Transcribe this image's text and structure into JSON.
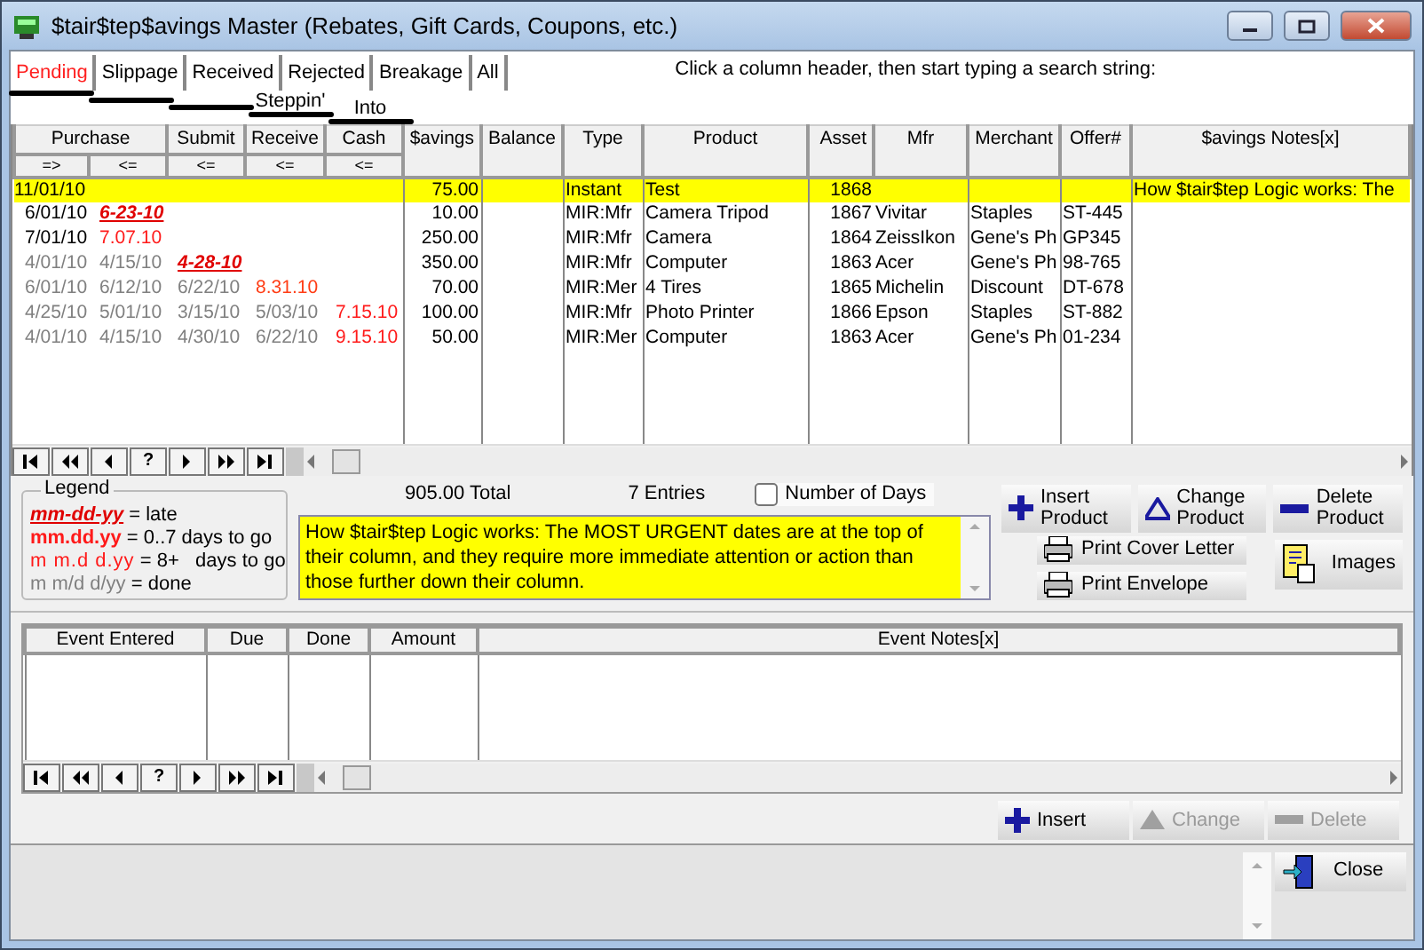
{
  "window": {
    "title": "$tair$tep$avings Master (Rebates, Gift Cards, Coupons, etc.)"
  },
  "tabs": [
    {
      "label": "Pending",
      "selected": true
    },
    {
      "label": "Slippage",
      "selected": false
    },
    {
      "label": "Received",
      "selected": false
    },
    {
      "label": "Rejected",
      "selected": false
    },
    {
      "label": "Breakage",
      "selected": false
    },
    {
      "label": "All",
      "selected": false
    }
  ],
  "stair_labels": [
    "Steppin'",
    "Into"
  ],
  "hint": "Click a column header, then start typing a search string:",
  "table": {
    "columns": [
      {
        "label": "Purchase",
        "sort": [
          "=>",
          "<="
        ]
      },
      {
        "label": "Submit",
        "sort": [
          "<="
        ]
      },
      {
        "label": "Receive",
        "sort": [
          "<="
        ]
      },
      {
        "label": "Cash",
        "sort": [
          "<="
        ]
      },
      {
        "label": "$avings",
        "numeric": true
      },
      {
        "label": "Balance"
      },
      {
        "label": "Type"
      },
      {
        "label": "Product"
      },
      {
        "label": "Asset",
        "numeric": true
      },
      {
        "label": "Mfr"
      },
      {
        "label": "Merchant"
      },
      {
        "label": "Offer#"
      },
      {
        "label": "$avings Notes[x]"
      }
    ],
    "rows": [
      {
        "selected": true,
        "dates": [
          {
            "text": "11/01/10",
            "kind": "open"
          }
        ],
        "savings": "75.00",
        "type": "Instant",
        "product": "Test",
        "asset": "1868",
        "notes": "How $tair$tep Logic works: The"
      },
      {
        "selected": false,
        "dates": [
          {
            "text": "6/01/10",
            "kind": "open"
          },
          {
            "text": "6-23-10",
            "kind": "late"
          }
        ],
        "savings": "10.00",
        "type": "MIR:Mfr",
        "product": "Camera Tripod",
        "asset": "1867",
        "mfr": "Vivitar",
        "merchant": "Staples",
        "offer": "ST-445"
      },
      {
        "selected": false,
        "dates": [
          {
            "text": "7/01/10",
            "kind": "open"
          },
          {
            "text": "7.07.10",
            "kind": "due"
          }
        ],
        "savings": "250.00",
        "type": "MIR:Mfr",
        "product": "Camera",
        "asset": "1864",
        "mfr": "ZeissIkon",
        "merchant": "Gene's Ph",
        "offer": "GP345"
      },
      {
        "selected": false,
        "dates": [
          {
            "text": "4/01/10",
            "kind": "done"
          },
          {
            "text": "4/15/10",
            "kind": "done"
          },
          {
            "text": "4-28-10",
            "kind": "late"
          }
        ],
        "savings": "350.00",
        "type": "MIR:Mfr",
        "product": "Computer",
        "asset": "1863",
        "mfr": "Acer",
        "merchant": "Gene's Ph",
        "offer": "98-765"
      },
      {
        "selected": false,
        "dates": [
          {
            "text": "6/01/10",
            "kind": "done"
          },
          {
            "text": "6/12/10",
            "kind": "done"
          },
          {
            "text": "6/22/10",
            "kind": "done"
          },
          {
            "text": "8.31.10",
            "kind": "later"
          }
        ],
        "savings": "70.00",
        "type": "MIR:Mer",
        "product": "4 Tires",
        "asset": "1865",
        "mfr": "Michelin",
        "merchant": "Discount",
        "offer": "DT-678"
      },
      {
        "selected": false,
        "dates": [
          {
            "text": "4/25/10",
            "kind": "done"
          },
          {
            "text": "5/01/10",
            "kind": "done"
          },
          {
            "text": "3/15/10",
            "kind": "done"
          },
          {
            "text": "5/03/10",
            "kind": "done"
          },
          {
            "text": "7.15.10",
            "kind": "due"
          }
        ],
        "savings": "100.00",
        "type": "MIR:Mfr",
        "product": "Photo Printer",
        "asset": "1866",
        "mfr": "Epson",
        "merchant": "Staples",
        "offer": "ST-882"
      },
      {
        "selected": false,
        "dates": [
          {
            "text": "4/01/10",
            "kind": "done"
          },
          {
            "text": "4/15/10",
            "kind": "done"
          },
          {
            "text": "4/30/10",
            "kind": "done"
          },
          {
            "text": "6/22/10",
            "kind": "done"
          },
          {
            "text": "9.15.10",
            "kind": "due"
          }
        ],
        "savings": "50.00",
        "type": "MIR:Mer",
        "product": "Computer",
        "asset": "1863",
        "mfr": "Acer",
        "merchant": "Gene's Ph",
        "offer": "01-234"
      }
    ],
    "nav_help": "?"
  },
  "legend": {
    "title": "Legend",
    "items": [
      {
        "kind": "late",
        "sample": "mm-dd-yy",
        "meaning": "= late"
      },
      {
        "kind": "soon",
        "sample": "mm.dd.yy",
        "meaning": "= 0..7 days to go"
      },
      {
        "kind": "later",
        "sample": "m m.d d.yy",
        "meaning": "= 8+   days to go"
      },
      {
        "kind": "done",
        "sample": "m m/d d/yy",
        "meaning": "= done"
      }
    ]
  },
  "total": "905.00 Total",
  "entries": "7 Entries",
  "number_of_days": {
    "label": "Number of Days",
    "checked": false
  },
  "logic_note": "How $tair$tep Logic works: The MOST URGENT dates are at the top of their column, and they require more immediate attention or action than those further down their column.",
  "product_buttons": [
    {
      "kind": "insert",
      "lines": [
        "Insert",
        "Product"
      ],
      "disabled": false
    },
    {
      "kind": "change",
      "lines": [
        "Change",
        "Product"
      ],
      "disabled": false
    },
    {
      "kind": "delete",
      "lines": [
        "Delete",
        "Product"
      ],
      "disabled": false
    }
  ],
  "print_buttons": [
    "Print Cover Letter",
    "Print Envelope"
  ],
  "images_button": "Images",
  "events": {
    "columns": [
      "Event Entered",
      "Due",
      "Done",
      "Amount",
      "Event Notes[x]"
    ],
    "nav_help": "?"
  },
  "event_buttons": [
    {
      "kind": "insert",
      "label": "Insert",
      "disabled": false
    },
    {
      "kind": "change",
      "label": "Change",
      "disabled": true
    },
    {
      "kind": "delete",
      "label": "Delete",
      "disabled": true
    }
  ],
  "close_button": "Close"
}
